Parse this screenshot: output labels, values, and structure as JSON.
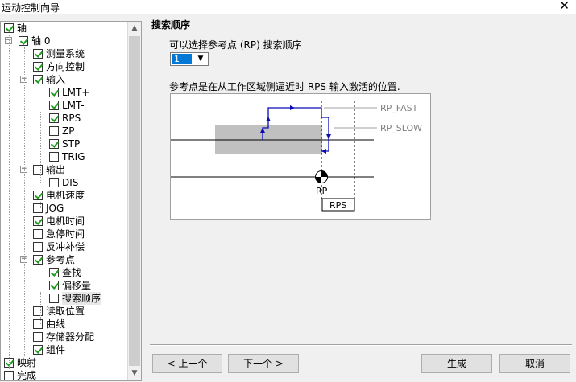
{
  "window": {
    "title": "运动控制向导",
    "close_glyph": "✕"
  },
  "tree": {
    "items": [
      {
        "label": "轴",
        "level": 0,
        "check": "on",
        "expander": ""
      },
      {
        "label": "轴 0",
        "level": 1,
        "check": "on",
        "expander": "−"
      },
      {
        "label": "测量系统",
        "level": 2,
        "check": "on",
        "expander": ""
      },
      {
        "label": "方向控制",
        "level": 2,
        "check": "on",
        "expander": ""
      },
      {
        "label": "输入",
        "level": 2,
        "check": "on",
        "expander": "−"
      },
      {
        "label": "LMT+",
        "level": 3,
        "check": "on",
        "expander": ""
      },
      {
        "label": "LMT-",
        "level": 3,
        "check": "on",
        "expander": ""
      },
      {
        "label": "RPS",
        "level": 3,
        "check": "on",
        "expander": ""
      },
      {
        "label": "ZP",
        "level": 3,
        "check": "off",
        "expander": ""
      },
      {
        "label": "STP",
        "level": 3,
        "check": "on",
        "expander": ""
      },
      {
        "label": "TRIG",
        "level": 3,
        "check": "off",
        "expander": ""
      },
      {
        "label": "输出",
        "level": 2,
        "check": "off",
        "expander": "−"
      },
      {
        "label": "DIS",
        "level": 3,
        "check": "off",
        "expander": ""
      },
      {
        "label": "电机速度",
        "level": 2,
        "check": "on",
        "expander": ""
      },
      {
        "label": "JOG",
        "level": 2,
        "check": "off",
        "expander": ""
      },
      {
        "label": "电机时间",
        "level": 2,
        "check": "on",
        "expander": ""
      },
      {
        "label": "急停时间",
        "level": 2,
        "check": "off",
        "expander": ""
      },
      {
        "label": "反冲补偿",
        "level": 2,
        "check": "off",
        "expander": ""
      },
      {
        "label": "参考点",
        "level": 2,
        "check": "on",
        "expander": "−"
      },
      {
        "label": "查找",
        "level": 3,
        "check": "on",
        "expander": ""
      },
      {
        "label": "偏移量",
        "level": 3,
        "check": "on",
        "expander": ""
      },
      {
        "label": "搜索顺序",
        "level": 3,
        "check": "off",
        "expander": "",
        "selected": true
      },
      {
        "label": "读取位置",
        "level": 2,
        "check": "off",
        "expander": ""
      },
      {
        "label": "曲线",
        "level": 2,
        "check": "off",
        "expander": ""
      },
      {
        "label": "存储器分配",
        "level": 2,
        "check": "off",
        "expander": ""
      },
      {
        "label": "组件",
        "level": 2,
        "check": "on",
        "expander": ""
      },
      {
        "label": "映射",
        "level": 0,
        "check": "on",
        "expander": ""
      },
      {
        "label": "完成",
        "level": 0,
        "check": "off",
        "expander": ""
      }
    ],
    "scroll_up_icon": "▲",
    "scroll_down_icon": "▼"
  },
  "main": {
    "heading": "搜索顺序",
    "prompt": "可以选择参考点 (RP) 搜索顺序",
    "combo_value": "1",
    "combo_arrow": "▼",
    "description": "参考点是在从工作区域侧逼近时 RPS 输入激活的位置.",
    "diagram": {
      "label_fast": "RP_FAST",
      "label_slow": "RP_SLOW",
      "label_rp": "RP",
      "label_rps": "RPS",
      "colors": {
        "path": "#0a0ab4",
        "zone": "#c0c0c0",
        "guide": "#a0a0a0"
      }
    }
  },
  "buttons": {
    "prev": "< 上一个",
    "next": "下一个 >",
    "finish": "生成",
    "cancel": "取消"
  }
}
